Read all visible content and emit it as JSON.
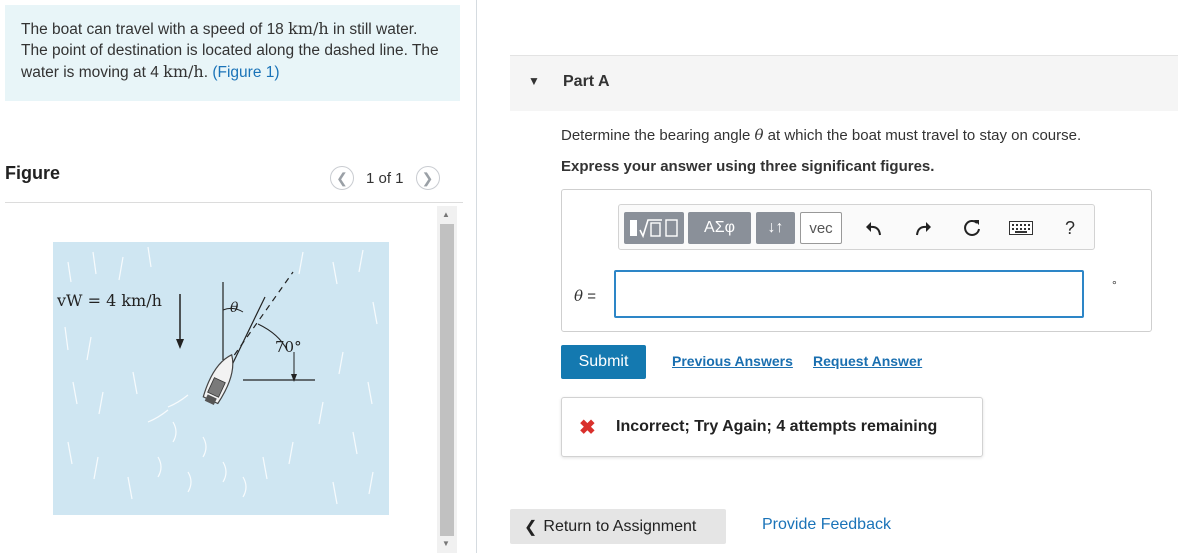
{
  "problem": {
    "text_1": "The boat can travel with a speed of 18 ",
    "unit_1": "km/h",
    "text_2": " in still water. The point of destination is located along the dashed line. The water is moving at 4 ",
    "unit_2": "km/h",
    "text_3": ". ",
    "figure_link": "(Figure 1)"
  },
  "figure": {
    "title": "Figure",
    "pager_text": "1 of 1",
    "prev_icon": "chevron-left-icon",
    "next_icon": "chevron-right-icon",
    "vw_label": "vW = 4 km/h",
    "angle_label_theta": "θ",
    "angle_label_70": "70°",
    "water_color": "#cfe6f2"
  },
  "part": {
    "caret_icon": "caret-down-icon",
    "title": "Part A",
    "question_1": "Determine the bearing angle ",
    "question_theta": "θ",
    "question_2": " at which the boat must travel to stay on course.",
    "instruction": "Express your answer using three significant figures."
  },
  "toolbar": {
    "template_icon": "fraction-sqrt-template-icon",
    "greek_label": "ΑΣφ",
    "arrows_label": "↓↑",
    "vec_label": "vec",
    "undo_icon": "undo-icon",
    "redo_icon": "redo-icon",
    "reset_icon": "reset-icon",
    "keyboard_icon": "keyboard-icon",
    "help_label": "?"
  },
  "answer": {
    "label_theta": "θ",
    "label_eq": " =",
    "value": "",
    "unit": "°"
  },
  "actions": {
    "submit": "Submit",
    "previous_answers": "Previous Answers",
    "request_answer": "Request Answer"
  },
  "feedback": {
    "message": "Incorrect; Try Again; 4 attempts remaining"
  },
  "footer": {
    "return_label": "Return to Assignment",
    "provide_feedback": "Provide Feedback"
  }
}
